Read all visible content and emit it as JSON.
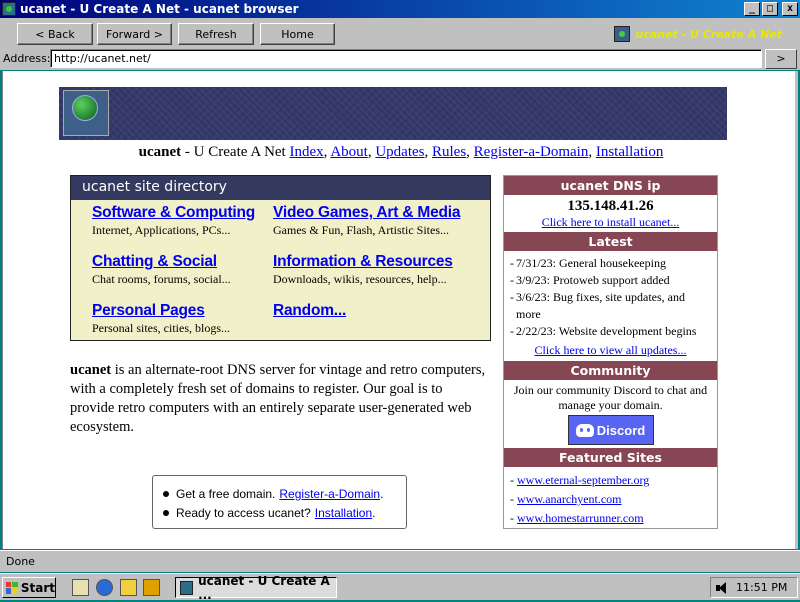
{
  "window": {
    "title": "ucanet - U Create A Net - ucanet browser",
    "minimize": "_",
    "maximize": "□",
    "close": "x"
  },
  "toolbar": {
    "back": "< Back",
    "forward": "Forward >",
    "refresh": "Refresh",
    "home": "Home",
    "brand": "ucanet - U Create A Net"
  },
  "address": {
    "label": "Address:",
    "url": "http://ucanet.net/",
    "go": ">"
  },
  "page": {
    "navline": {
      "site": "ucanet",
      "tagline": " - U Create A Net ",
      "links": [
        "Index",
        "About",
        "Updates",
        "Rules",
        "Register-a-Domain",
        "Installation"
      ]
    },
    "directory": {
      "title": "ucanet site directory",
      "items": [
        {
          "title": "Software & Computing",
          "desc": "Internet, Applications, PCs..."
        },
        {
          "title": "Video Games, Art & Media",
          "desc": "Games & Fun, Flash, Artistic Sites..."
        },
        {
          "title": "Chatting & Social",
          "desc": "Chat rooms, forums, social..."
        },
        {
          "title": "Information & Resources",
          "desc": "Downloads, wikis, resources, help..."
        },
        {
          "title": "Personal Pages",
          "desc": "Personal sites, cities, blogs..."
        },
        {
          "title": "Random...",
          "desc": ""
        }
      ]
    },
    "about": {
      "bold": "ucanet",
      "text": " is an alternate-root DNS server for vintage and retro computers, with a completely fresh set of domains to register. Our goal is to provide retro computers with an entirely separate user-generated web ecosystem."
    },
    "cta": [
      {
        "text": "Get a free domain.",
        "link": "Register-a-Domain",
        "suffix": "."
      },
      {
        "text": "Ready to access ucanet?",
        "link": "Installation",
        "suffix": "."
      }
    ],
    "sidebar": {
      "dns_title": "ucanet DNS ip",
      "dns_ip": "135.148.41.26",
      "install_link": "Click here to install ucanet...",
      "latest_title": "Latest",
      "latest": [
        "7/31/23: General housekeeping",
        "3/9/23: Protoweb support added",
        "3/6/23: Bug fixes, site updates, and more",
        "2/22/23: Website development begins"
      ],
      "updates_link": "Click here to view all updates...",
      "community_title": "Community",
      "community_text": "Join our community Discord to chat and manage your domain.",
      "discord_label": "Discord",
      "featured_title": "Featured Sites",
      "featured": [
        "www.eternal-september.org",
        "www.anarchyent.com",
        "www.homestarrunner.com"
      ]
    }
  },
  "status": "Done",
  "taskbar": {
    "start": "Start",
    "task": "ucanet - U Create A ...",
    "clock": "11:51 PM"
  }
}
